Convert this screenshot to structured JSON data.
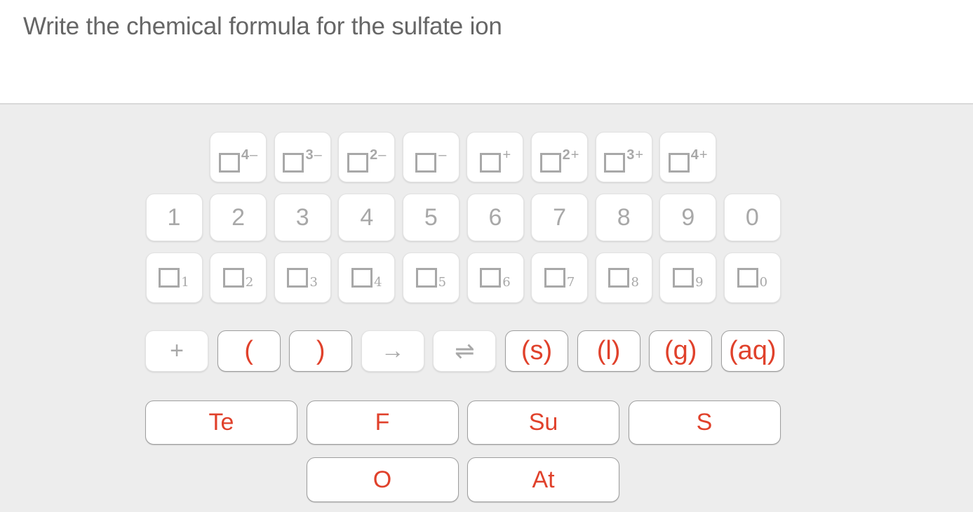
{
  "question": {
    "text": "Write the chemical formula for the sulfate ion"
  },
  "colors": {
    "accent_red": "#e0412b",
    "disabled_gray": "#a8a8a8",
    "keypad_background": "#ededed"
  },
  "keypad": {
    "charges": [
      {
        "magnitude": "4",
        "sign": "–"
      },
      {
        "magnitude": "3",
        "sign": "–"
      },
      {
        "magnitude": "2",
        "sign": "–"
      },
      {
        "magnitude": "",
        "sign": "–"
      },
      {
        "magnitude": "",
        "sign": "+"
      },
      {
        "magnitude": "2",
        "sign": "+"
      },
      {
        "magnitude": "3",
        "sign": "+"
      },
      {
        "magnitude": "4",
        "sign": "+"
      }
    ],
    "numbers": [
      "1",
      "2",
      "3",
      "4",
      "5",
      "6",
      "7",
      "8",
      "9",
      "0"
    ],
    "subscripts": [
      "1",
      "2",
      "3",
      "4",
      "5",
      "6",
      "7",
      "8",
      "9",
      "0"
    ],
    "symbols": [
      {
        "label": "+",
        "name": "plus",
        "enabled": false
      },
      {
        "label": "(",
        "name": "open-paren",
        "enabled": true
      },
      {
        "label": ")",
        "name": "close-paren",
        "enabled": true
      },
      {
        "label": "→",
        "name": "reaction-arrow",
        "enabled": false
      },
      {
        "label": "⇌",
        "name": "equilibrium-arrow",
        "enabled": false
      },
      {
        "label": "(s)",
        "name": "solid-state",
        "enabled": true
      },
      {
        "label": "(l)",
        "name": "liquid-state",
        "enabled": true
      },
      {
        "label": "(g)",
        "name": "gas-state",
        "enabled": true
      },
      {
        "label": "(aq)",
        "name": "aqueous-state",
        "enabled": true
      }
    ],
    "elements_row1": [
      "Te",
      "F",
      "Su",
      "S"
    ],
    "elements_row2": [
      "O",
      "At"
    ]
  }
}
